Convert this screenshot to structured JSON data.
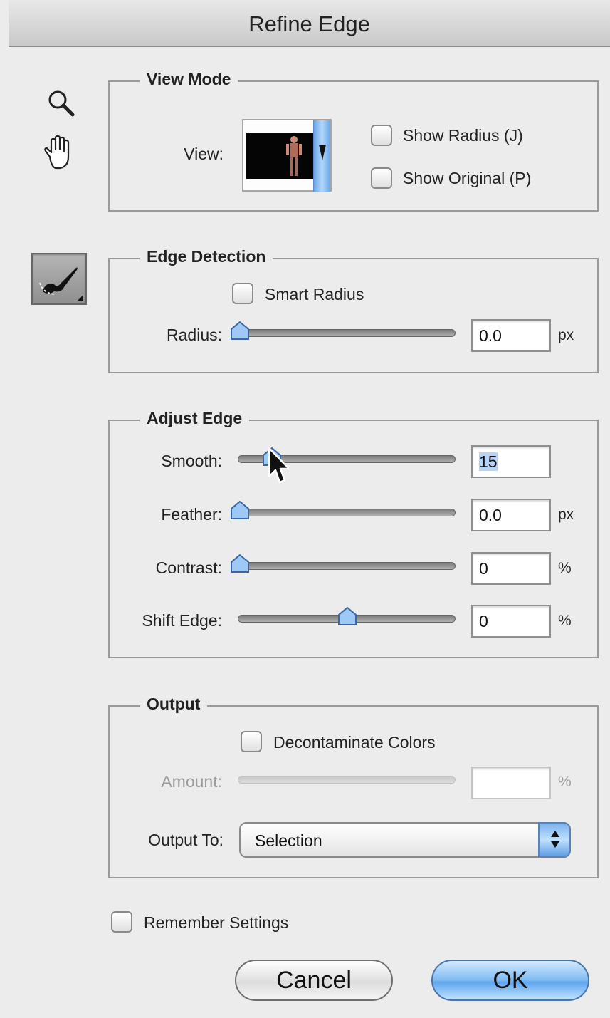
{
  "window": {
    "title": "Refine Edge"
  },
  "tools": {
    "zoom_icon": "magnifier-icon",
    "hand_icon": "hand-icon",
    "brush_icon": "refine-radius-brush-icon"
  },
  "view_mode": {
    "title": "View Mode",
    "view_label": "View:",
    "show_radius": {
      "label": "Show Radius (J)",
      "checked": false
    },
    "show_original": {
      "label": "Show Original (P)",
      "checked": false
    }
  },
  "edge_detection": {
    "title": "Edge Detection",
    "smart_radius": {
      "label": "Smart Radius",
      "checked": false
    },
    "radius": {
      "label": "Radius:",
      "value": "0.0",
      "unit": "px",
      "slider_fraction": 0.0
    }
  },
  "adjust_edge": {
    "title": "Adjust Edge",
    "smooth": {
      "label": "Smooth:",
      "value": "15",
      "slider_fraction": 0.15
    },
    "feather": {
      "label": "Feather:",
      "value": "0.0",
      "unit": "px",
      "slider_fraction": 0.0
    },
    "contrast": {
      "label": "Contrast:",
      "value": "0",
      "unit": "%",
      "slider_fraction": 0.0
    },
    "shift_edge": {
      "label": "Shift Edge:",
      "value": "0",
      "unit": "%",
      "slider_fraction": 0.5
    }
  },
  "output": {
    "title": "Output",
    "decontaminate": {
      "label": "Decontaminate Colors",
      "checked": false
    },
    "amount": {
      "label": "Amount:",
      "value": "",
      "unit": "%",
      "enabled": false
    },
    "output_to": {
      "label": "Output To:",
      "selected": "Selection"
    }
  },
  "remember": {
    "label": "Remember Settings",
    "checked": false
  },
  "buttons": {
    "cancel": "Cancel",
    "ok": "OK"
  },
  "colors": {
    "accent": "#6aa7e8",
    "selection": "#b8d3f5"
  }
}
